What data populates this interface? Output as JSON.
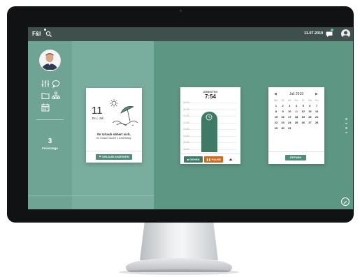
{
  "topbar": {
    "logo": "F&I",
    "date": "11.07.2019"
  },
  "sidebar": {
    "vacation_count": "3",
    "vacation_label": "Ferientage"
  },
  "vacation_card": {
    "day": "11",
    "month": "Do., Juli",
    "message": "Ihr Urlaub nähert sich.",
    "sub_message": "Ihr Urlaub dauert 1 Arbeitstag.",
    "button_label": "URLAUB ANZEIGEN"
  },
  "time_card": {
    "title": "ARBEITEN",
    "value": "7:54",
    "timeline_labels": [
      "09:00",
      "10:00",
      "11:00",
      "12:00",
      "13:00",
      "14:00",
      "15:00",
      "16:00"
    ],
    "button_gehen": "GEHEN",
    "button_pause": "PAUSE"
  },
  "calendar_card": {
    "month_label": "Juli 2019",
    "weekdays": [
      "Mo",
      "Di",
      "Mi",
      "Do",
      "Fr",
      "Sa",
      "So"
    ],
    "days": [
      "1",
      "2",
      "3",
      "4",
      "5",
      "6",
      "7",
      "8",
      "9",
      "10",
      "11",
      "12",
      "13",
      "14",
      "15",
      "16",
      "17",
      "18",
      "19",
      "20",
      "21",
      "22",
      "23",
      "24",
      "25",
      "26",
      "27",
      "28",
      "29",
      "30",
      "31"
    ],
    "today": "11",
    "button_label": "ÖFFNEN"
  },
  "colors": {
    "screen_bg": "#5e9684",
    "topbar": "#3e4f4c",
    "accent_green": "#4f8c7a",
    "pause_orange": "#d26a1e",
    "today_red": "#d24a3a"
  },
  "icons": [
    "search-icon",
    "chat-icon",
    "settings-icon",
    "comment-icon",
    "folder-icon",
    "org-chart-icon",
    "calendar-icon",
    "beach-icon",
    "clock-icon",
    "umbrella-icon",
    "edit-icon"
  ]
}
